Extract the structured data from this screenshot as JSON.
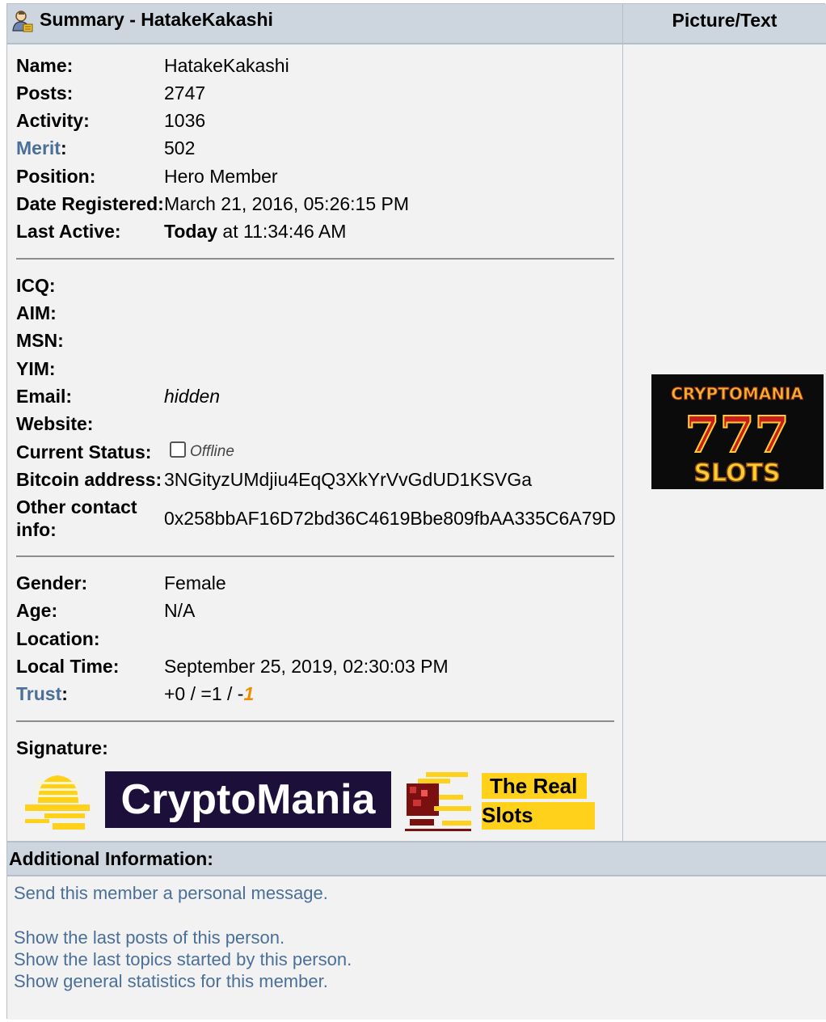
{
  "header": {
    "summary_title": "Summary - HatakeKakashi",
    "picture_title": "Picture/Text",
    "user_icon": "user-icon"
  },
  "profile": {
    "name_label": "Name:",
    "name": "HatakeKakashi",
    "posts_label": "Posts:",
    "posts": "2747",
    "activity_label": "Activity:",
    "activity": "1036",
    "merit_link": "Merit",
    "merit_colon": ":",
    "merit": "502",
    "position_label": "Position:",
    "position": "Hero Member",
    "registered_label": "Date Registered:",
    "registered": "March 21, 2016, 05:26:15 PM",
    "last_active_label": "Last Active:",
    "last_active_today": "Today",
    "last_active_time": " at 11:34:46 AM"
  },
  "contact": {
    "icq_label": "ICQ:",
    "aim_label": "AIM:",
    "msn_label": "MSN:",
    "yim_label": "YIM:",
    "email_label": "Email:",
    "email": "hidden",
    "website_label": "Website:",
    "status_label": "Current Status:",
    "status": "Offline",
    "bitcoin_label": "Bitcoin address:",
    "bitcoin": "3NGityzUMdjiu4EqQ3XkYrVvGdUD1KSVGa",
    "other_label_1": "Other contact",
    "other_label_2": "info:",
    "other": "0x258bbAF16D72bd36C4619Bbe809fbAA335C6A79D"
  },
  "personal": {
    "gender_label": "Gender:",
    "gender": "Female",
    "age_label": "Age:",
    "age": "N/A",
    "location_label": "Location:",
    "localtime_label": "Local Time:",
    "localtime": "September 25, 2019, 02:30:03 PM",
    "trust_link": "Trust",
    "trust_colon": ":",
    "trust_prefix": "+0 / =1 / -",
    "trust_negative": "1",
    "trust_negative_color": "#f28c00"
  },
  "signature": {
    "label": "Signature:",
    "brand": "CryptoMania",
    "tagline_1": "The Real",
    "tagline_2": "Slots",
    "brand_bg": "#1c0f3a",
    "tagline_bg": "#ffd11a"
  },
  "side_image": {
    "top_text": "CRYPTOMANIA",
    "middle_text": "777",
    "bottom_text": "SLOTS"
  },
  "additional": {
    "title": "Additional Information:",
    "send_pm": "Send this member a personal message.",
    "last_posts": "Show the last posts of this person.",
    "last_topics": "Show the last topics started by this person.",
    "stats": "Show general statistics for this member."
  },
  "colors": {
    "header_bg": "#cdd6df",
    "link": "#4a6f99",
    "panel_bg": "#f2f2f2"
  }
}
